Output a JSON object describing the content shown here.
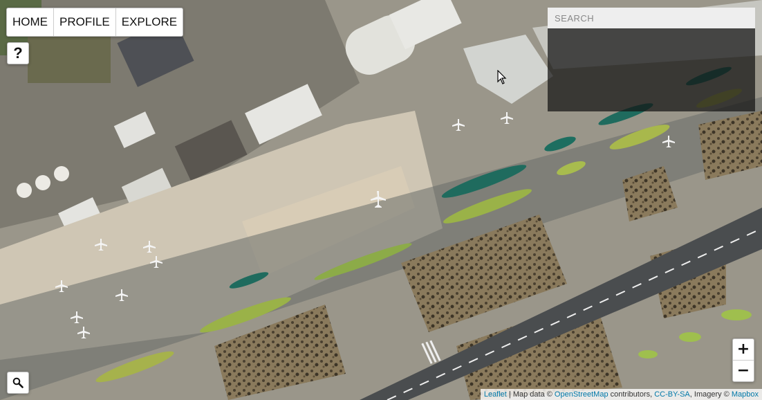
{
  "nav": {
    "items": [
      {
        "label": "HOME"
      },
      {
        "label": "PROFILE"
      },
      {
        "label": "EXPLORE"
      }
    ]
  },
  "help": {
    "label": "?"
  },
  "search": {
    "placeholder": "SEARCH",
    "value": ""
  },
  "zoom": {
    "in_label": "+",
    "out_label": "−"
  },
  "attribution": {
    "leaflet": "Leaflet",
    "sep1": " | Map data © ",
    "osm": "OpenStreetMap",
    "contributors": " contributors, ",
    "license": "CC-BY-SA",
    "imagery": ", Imagery © ",
    "provider": "Mapbox"
  },
  "colors": {
    "link": "#0078a8",
    "panel": "#141414"
  },
  "icons": {
    "search": "magnifier-icon",
    "cursor": "pointer-cursor-icon"
  }
}
